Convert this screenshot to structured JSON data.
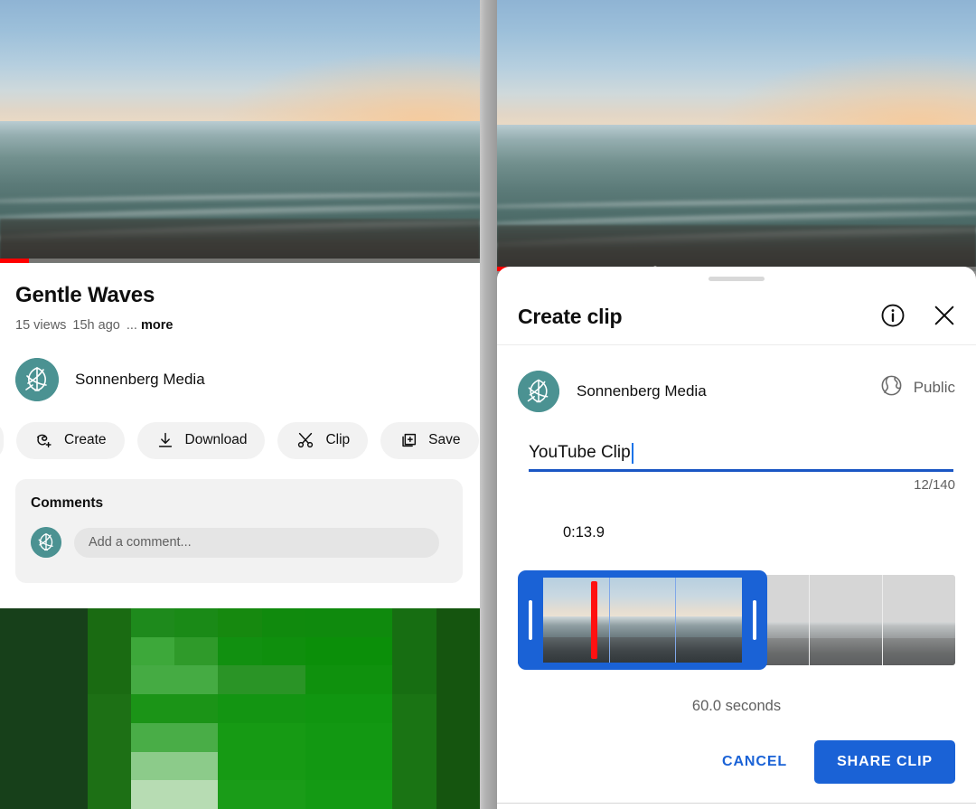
{
  "left_panel": {
    "video": {
      "progress_percent": 6
    },
    "title": "Gentle Waves",
    "meta": {
      "views": "15 views",
      "uploaded": "15h ago",
      "dots": "...",
      "more": "more"
    },
    "channel": {
      "name": "Sonnenberg Media",
      "avatar_icon": "leaf-globe-logo"
    },
    "actions": [
      {
        "label": "Create",
        "icon": "create-icon"
      },
      {
        "label": "Download",
        "icon": "download-icon"
      },
      {
        "label": "Clip",
        "icon": "scissors-icon"
      },
      {
        "label": "Save",
        "icon": "save-library-icon"
      }
    ],
    "comments": {
      "heading": "Comments",
      "input_placeholder": "Add a comment...",
      "avatar_icon": "leaf-globe-logo"
    }
  },
  "right_panel": {
    "video": {
      "progress_percent": 33
    },
    "sheet": {
      "title": "Create clip",
      "info_icon": "info-circle-icon",
      "close_icon": "close-x-icon",
      "channel": {
        "name": "Sonnenberg Media",
        "avatar_icon": "leaf-globe-logo"
      },
      "privacy": {
        "label": "Public",
        "icon": "globe-icon"
      },
      "clip_title_input": {
        "value": "YouTube Clip",
        "counter": "12/140"
      },
      "timeline": {
        "start_time_label": "0:13.9",
        "duration_label": "60.0 seconds",
        "selection_start_percent": 0,
        "selection_width_percent": 57,
        "playhead_percent": 24
      },
      "buttons": {
        "cancel": "CANCEL",
        "share": "SHARE CLIP"
      }
    }
  },
  "colors": {
    "accent_blue": "#1a62d6",
    "progress_red": "#ff0000",
    "avatar_teal": "#4b9292",
    "chip_grey": "#f2f2f2",
    "muted_text": "#606060"
  }
}
